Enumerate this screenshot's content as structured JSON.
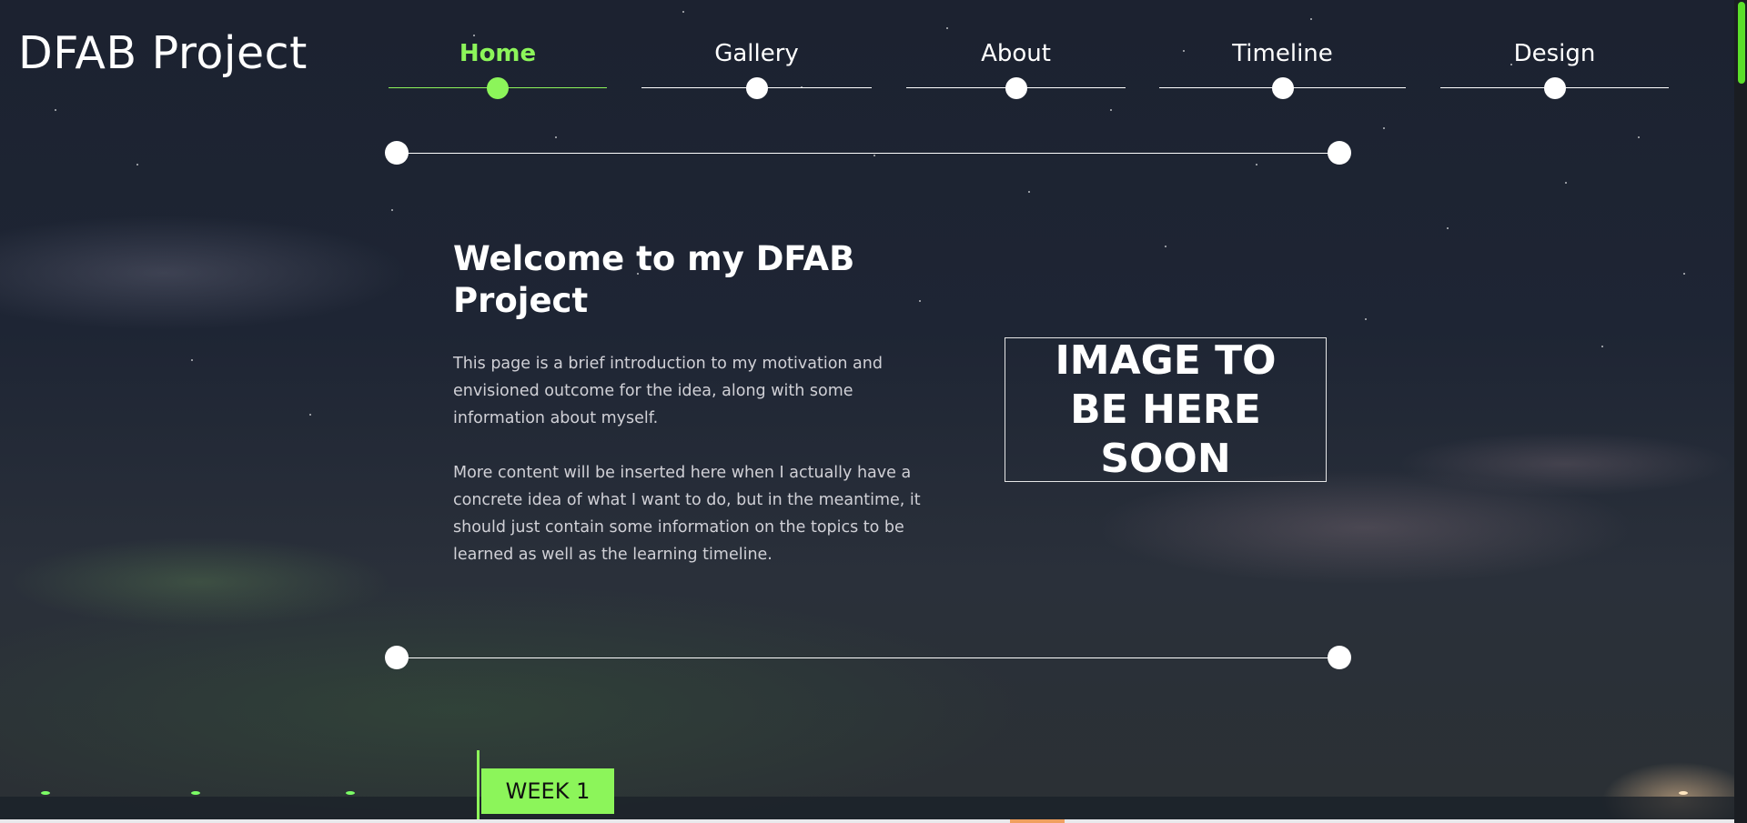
{
  "brand": {
    "title": "DFAB Project"
  },
  "nav": {
    "items": [
      {
        "label": "Home",
        "active": true
      },
      {
        "label": "Gallery",
        "active": false
      },
      {
        "label": "About",
        "active": false
      },
      {
        "label": "Timeline",
        "active": false
      },
      {
        "label": "Design",
        "active": false
      }
    ]
  },
  "welcome": {
    "title": "Welcome to my DFAB Project",
    "paragraph_1": "This page is a brief introduction to my motivation and envisioned outcome for the idea, along with some information about myself.",
    "paragraph_2": "More content will be inserted here when I actually have a concrete idea of what I want to do, but in the meantime, it should just contain some information on the topics to be learned as well as the learning timeline."
  },
  "image_placeholder": {
    "text": "IMAGE TO BE HERE SOON"
  },
  "timeline": {
    "first_tag": "WEEK 1"
  },
  "colors": {
    "accent": "#8cf55a",
    "text": "#ffffff",
    "body_text": "#d0d0d6",
    "background": "#1e2534"
  }
}
